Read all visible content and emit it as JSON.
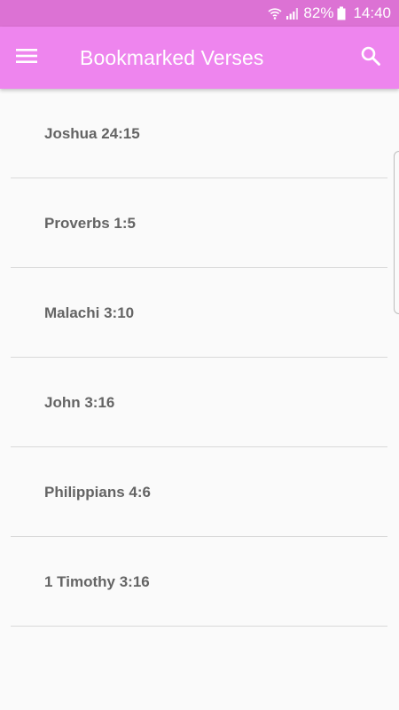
{
  "status_bar": {
    "battery_percent": "82%",
    "time": "14:40",
    "icons": [
      "wifi-icon",
      "signal-icon",
      "battery-icon"
    ]
  },
  "app_bar": {
    "title": "Bookmarked Verses",
    "menu_icon": "hamburger-menu-icon",
    "search_icon": "search-icon"
  },
  "bookmarks": [
    {
      "reference": "Joshua 24:15"
    },
    {
      "reference": "Proverbs 1:5"
    },
    {
      "reference": "Malachi 3:10"
    },
    {
      "reference": "John 3:16"
    },
    {
      "reference": "Philippians 4:6"
    },
    {
      "reference": "1 Timothy 3:16"
    }
  ],
  "colors": {
    "status_bar": "#dc72d4",
    "app_bar": "#ee85ee",
    "background": "#fafafa",
    "label_text": "#646464",
    "divider": "#d9d9d9"
  }
}
